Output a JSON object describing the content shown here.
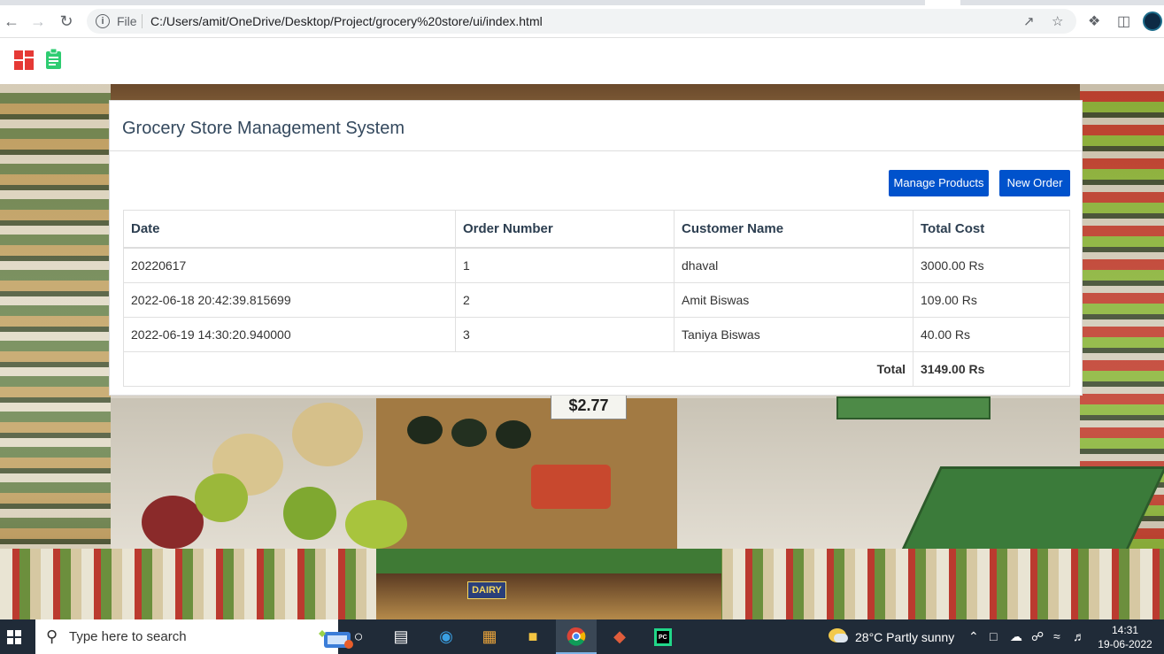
{
  "browser": {
    "scheme_label": "File",
    "url": "C:/Users/amit/OneDrive/Desktop/Project/grocery%20store/ui/index.html"
  },
  "app": {
    "title": "Grocery Store Management System",
    "buttons": {
      "manage_products": "Manage Products",
      "new_order": "New Order"
    },
    "table": {
      "headers": [
        "Date",
        "Order Number",
        "Customer Name",
        "Total Cost"
      ],
      "rows": [
        [
          "20220617",
          "1",
          "dhaval",
          "3000.00 Rs"
        ],
        [
          "2022-06-18 20:42:39.815699",
          "2",
          "Amit Biswas",
          "109.00 Rs"
        ],
        [
          "2022-06-19 14:30:20.940000",
          "3",
          "Taniya Biswas",
          "40.00 Rs"
        ]
      ],
      "total_label": "Total",
      "total_value": "3149.00 Rs"
    },
    "background": {
      "price_sign": "$2.77",
      "dairy_sign": "DAIRY"
    }
  },
  "taskbar": {
    "search_placeholder": "Type here to search",
    "weather": "28°C  Partly sunny",
    "time": "14:31",
    "date": "19-06-2022"
  },
  "colors": {
    "primary_button": "#0052cc",
    "heading_text": "#34495e",
    "logo_red": "#e53935",
    "logo_green": "#2ecc71"
  }
}
